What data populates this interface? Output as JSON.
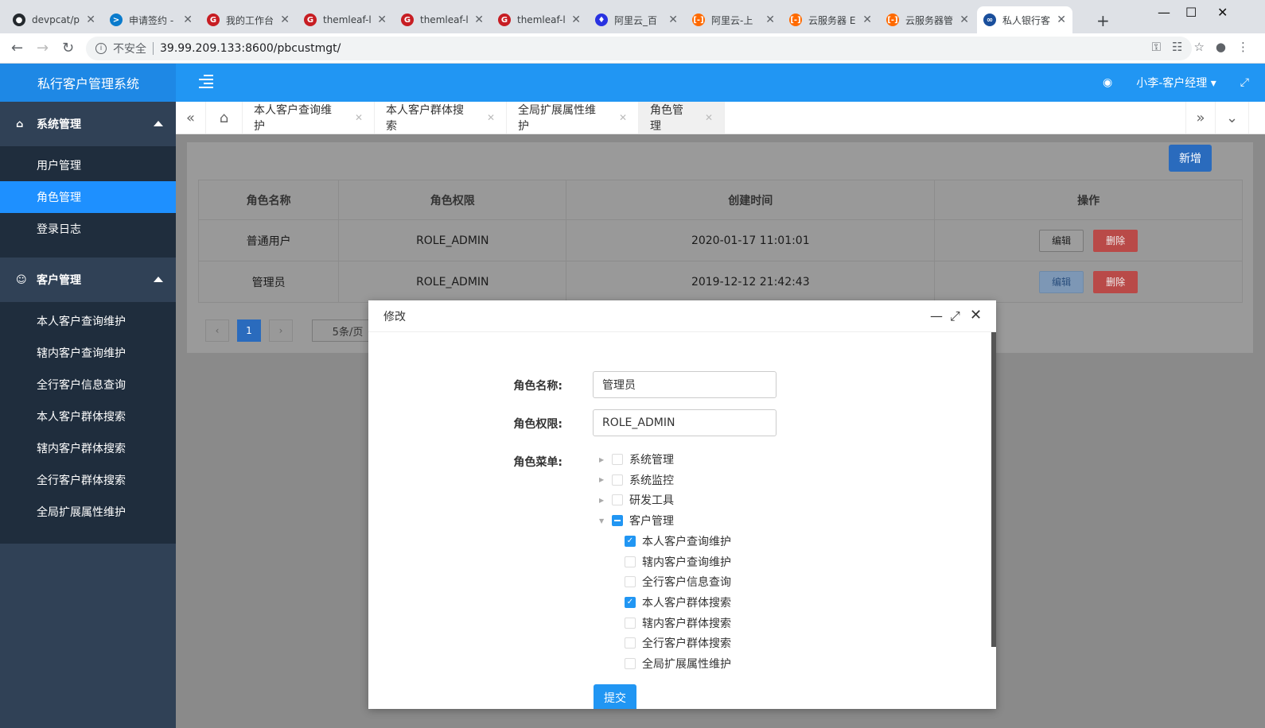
{
  "browser": {
    "tabs": [
      {
        "title": "devpcat/p",
        "icon": "github-icon",
        "color": "#24292e"
      },
      {
        "title": "申请签约 -",
        "icon": "terminal-icon",
        "color": "#0a7bcc"
      },
      {
        "title": "我的工作台",
        "icon": "gitee-icon",
        "color": "#c71d23"
      },
      {
        "title": "themleaf-l",
        "icon": "gitee-icon",
        "color": "#c71d23"
      },
      {
        "title": "themleaf-l",
        "icon": "gitee-icon",
        "color": "#c71d23"
      },
      {
        "title": "themleaf-l",
        "icon": "gitee-icon",
        "color": "#c71d23"
      },
      {
        "title": "阿里云_百",
        "icon": "baidu-icon",
        "color": "#2932e1"
      },
      {
        "title": "阿里云-上",
        "icon": "aliyun-icon",
        "color": "#ff6a00"
      },
      {
        "title": "云服务器 E",
        "icon": "aliyun-icon",
        "color": "#ff6a00"
      },
      {
        "title": "云服务器管",
        "icon": "aliyun-icon",
        "color": "#ff6a00"
      },
      {
        "title": "私人银行客",
        "icon": "bank-icon",
        "color": "#1a4f9c"
      }
    ],
    "insecure_label": "不安全",
    "url": "39.99.209.133:8600/pbcustmgt/"
  },
  "app": {
    "title": "私行客户管理系统",
    "user": "小李-客户经理"
  },
  "sidebar": {
    "groups": [
      {
        "label": "系统管理",
        "items": [
          "用户管理",
          "角色管理",
          "登录日志"
        ]
      },
      {
        "label": "客户管理",
        "items": [
          "本人客户查询维护",
          "辖内客户查询维护",
          "全行客户信息查询",
          "本人客户群体搜索",
          "辖内客户群体搜索",
          "全行客户群体搜索",
          "全局扩展属性维护"
        ]
      }
    ],
    "active_item": "角色管理"
  },
  "pagetabs": [
    "本人客户查询维护",
    "本人客户群体搜索",
    "全局扩展属性维护",
    "角色管理"
  ],
  "toolbar": {
    "add_label": "新增"
  },
  "table": {
    "headers": [
      "角色名称",
      "角色权限",
      "创建时间",
      "操作"
    ],
    "rows": [
      {
        "name": "普通用户",
        "perm": "ROLE_ADMIN",
        "created": "2020-01-17 11:01:01"
      },
      {
        "name": "管理员",
        "perm": "ROLE_ADMIN",
        "created": "2019-12-12 21:42:43"
      }
    ],
    "edit_label": "编辑",
    "delete_label": "删除"
  },
  "pager": {
    "current": "1",
    "page_size": "5条/页"
  },
  "modal": {
    "title": "修改",
    "name_label": "角色名称:",
    "name_value": "管理员",
    "perm_label": "角色权限:",
    "perm_value": "ROLE_ADMIN",
    "menu_label": "角色菜单:",
    "tree": [
      {
        "label": "系统管理",
        "state": "off",
        "level": 0,
        "arrow": "right"
      },
      {
        "label": "系统监控",
        "state": "off",
        "level": 0,
        "arrow": "right"
      },
      {
        "label": "研发工具",
        "state": "off",
        "level": 0,
        "arrow": "right"
      },
      {
        "label": "客户管理",
        "state": "half",
        "level": 0,
        "arrow": "down"
      },
      {
        "label": "本人客户查询维护",
        "state": "on",
        "level": 1
      },
      {
        "label": "辖内客户查询维护",
        "state": "off",
        "level": 1
      },
      {
        "label": "全行客户信息查询",
        "state": "off",
        "level": 1
      },
      {
        "label": "本人客户群体搜索",
        "state": "on",
        "level": 1
      },
      {
        "label": "辖内客户群体搜索",
        "state": "off",
        "level": 1
      },
      {
        "label": "全行客户群体搜索",
        "state": "off",
        "level": 1
      },
      {
        "label": "全局扩展属性维护",
        "state": "off",
        "level": 1
      }
    ],
    "submit_label": "提交"
  }
}
